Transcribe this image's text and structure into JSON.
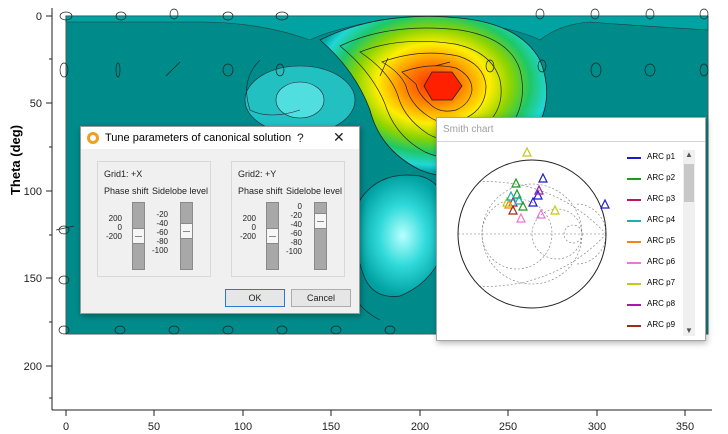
{
  "plot": {
    "y_title": "Theta (deg)",
    "y_ticks": [
      "0",
      "50",
      "100",
      "150",
      "200"
    ],
    "x_ticks": [
      "0",
      "50",
      "100",
      "150",
      "200",
      "250",
      "300",
      "350"
    ]
  },
  "dialog": {
    "title": "Tune parameters of canonical solution",
    "help": "?",
    "close": "✕",
    "grid1": {
      "title": "Grid1: +X",
      "phase_label": "Phase shift",
      "sidelobe_label": "Sidelobe level",
      "phase_ticks": [
        "200",
        "0",
        "-200"
      ],
      "sidelobe_ticks": [
        "-20",
        "-40",
        "-60",
        "-80",
        "-100"
      ],
      "phase_value": 0,
      "sidelobe_value": -40
    },
    "grid2": {
      "title": "Grid2: +Y",
      "phase_label": "Phase shift",
      "sidelobe_label": "Sidelobe level",
      "phase_ticks": [
        "200",
        "0",
        "-200"
      ],
      "sidelobe_ticks": [
        "0",
        "-20",
        "-40",
        "-60",
        "-80",
        "-100"
      ],
      "phase_value": 0,
      "sidelobe_value": -20
    },
    "ok": "OK",
    "cancel": "Cancel"
  },
  "smith": {
    "title": "Smith chart",
    "legend": [
      {
        "name": "ARC p1",
        "color": "#1a1acc"
      },
      {
        "name": "ARC p2",
        "color": "#1f9a1f"
      },
      {
        "name": "ARC p3",
        "color": "#c0155e"
      },
      {
        "name": "ARC p4",
        "color": "#18b0b0"
      },
      {
        "name": "ARC p5",
        "color": "#f08418"
      },
      {
        "name": "ARC p6",
        "color": "#ee74d8"
      },
      {
        "name": "ARC p7",
        "color": "#c8c818"
      },
      {
        "name": "ARC p8",
        "color": "#aa18aa"
      },
      {
        "name": "ARC p9",
        "color": "#a02818"
      }
    ]
  },
  "colors": {
    "teal_bg": "#008b8b",
    "plot_border": "#5a6a6a"
  }
}
